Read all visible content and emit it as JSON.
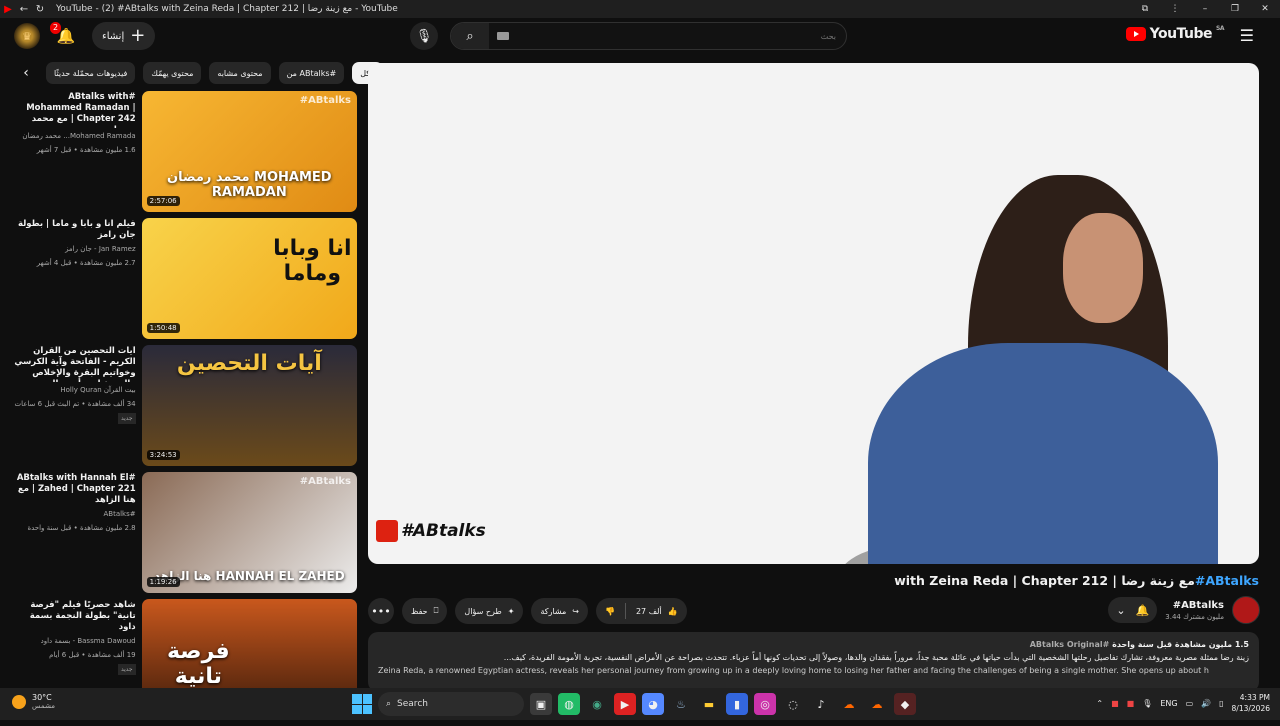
{
  "window": {
    "title": "YouTube - (2) #ABtalks with Zeina Reda | Chapter 212 | مع زينة رضا - YouTube"
  },
  "header": {
    "notifications_count": "2",
    "create_label": "إنشاء",
    "search_placeholder": "بحث",
    "logo_text": "YouTube",
    "logo_region": "SA"
  },
  "chips": [
    "الكل",
    "من ABtalks#",
    "محتوى مشابه",
    "محتوى يهمّك",
    "فيديوهات محمّلة حديثًا"
  ],
  "recommendations": [
    {
      "title": "#ABtalks with Mohammed Ramadan | Chapter 242 | مع محمد رمضان",
      "channel": "Mohamed Ramada... محمد رمضان",
      "meta": "1.6 مليون مشاهدة • قبل 7 أشهر",
      "duration": "2:57:06",
      "thumb_text": "محمد رمضان MOHAMED RAMADAN",
      "watermark": "#ABtalks",
      "new_badge": ""
    },
    {
      "title": "فيلم انا و بابا و ماما | بطولة جان رامز",
      "channel": "Jan Ramez - جان رامز",
      "meta": "2.7 مليون مشاهدة • قبل 4 أشهر",
      "duration": "1:50:48",
      "thumb_text": "انا وبابا وماما",
      "watermark": "",
      "new_badge": ""
    },
    {
      "title": "آيات التحصين من القرآن الكريم - الفاتحة وآية الكرسي وخواتيم البقرة والإخلاص والمعوذتان - أحمد العجمي",
      "channel": "بيت القرآن Holly Quran",
      "meta": "34 ألف مشاهدة • تم البث قبل 6 ساعات",
      "duration": "3:24:53",
      "thumb_text": "آيات التحصين",
      "watermark": "",
      "new_badge": "جديد"
    },
    {
      "title": "#ABtalks with Hannah El Zahed | Chapter 221 | مع هنا الزاهد",
      "channel": "#ABtalks",
      "meta": "2.8 مليون مشاهدة • قبل سنة واحدة",
      "duration": "1:19:26",
      "thumb_text": "هنا الزاهد HANNAH EL ZAHED",
      "watermark": "#ABtalks",
      "new_badge": ""
    },
    {
      "title": "شاهد حصريًا فيلم \"فرصة تانية\" بطولة النجمة بسمة داود",
      "channel": "Bassma Dawoud - بسمة داود",
      "meta": "19 ألف مشاهدة • قبل 6 أيام",
      "duration": "",
      "thumb_text": "فرصة تانية",
      "watermark": "",
      "new_badge": "جديد"
    }
  ],
  "video": {
    "watermark": "#ABtalks",
    "title_hash": "#ABtalks",
    "title_rest": "with Zeina Reda | Chapter 212 | مع زينة رضا",
    "channel_name": "#ABtalks",
    "subscribers": "3.44 مليون مشترك",
    "likes": "27 ألف",
    "share_label": "مشاركة",
    "ask_label": "طرح سؤال",
    "save_label": "حفظ",
    "more_label": "•••"
  },
  "description": {
    "stats": "1.5 مليون مشاهدة  قبل سنة واحدة",
    "original": "#ABtalks Original",
    "line1": "زينة رضا ممثلة مصرية معروفة، تشارك تفاصيل رحلتها الشخصية التي بدأت حياتها في عائلة محبة جداً، مروراً بفقدان والدها، وصولاً إلى تحديات كونها أماً عزباء. تتحدث بصراحة عن الأمراض النفسية، تجربة الأمومة الفريدة، كيف...",
    "line2": "Zeina Reda, a renowned Egyptian actress, reveals her personal journey from growing up in a deeply loving home to losing her father and facing the challenges of being a single mother. She opens up about h"
  },
  "taskbar": {
    "temperature": "30°C",
    "weather": "مشمس",
    "search_label": "Search",
    "language": "ENG",
    "time": "4:33 PM",
    "date": "8/13/2026"
  }
}
